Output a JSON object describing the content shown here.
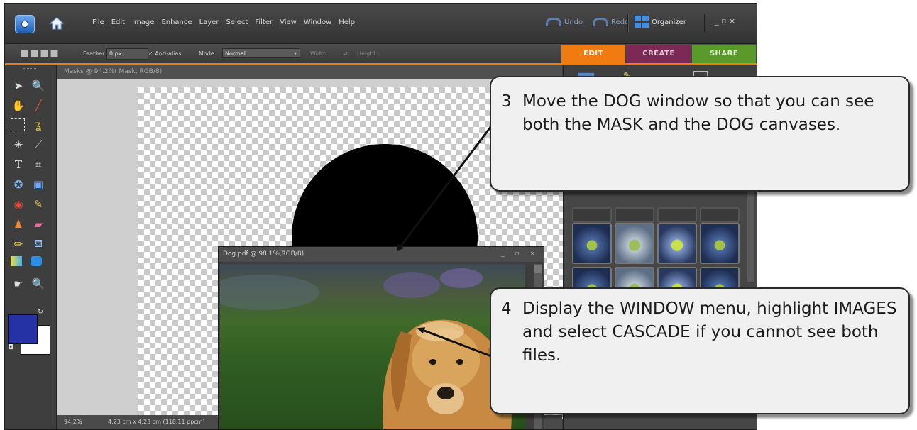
{
  "menubar": {
    "items": [
      "File",
      "Edit",
      "Image",
      "Enhance",
      "Layer",
      "Select",
      "Filter",
      "View",
      "Window",
      "Help"
    ],
    "undo_label": "Undo",
    "redo_label": "Redo",
    "organizer_label": "Organizer",
    "window_controls": "_  ▫  ×"
  },
  "options": {
    "feather_label": "Feather:",
    "feather_value": "0 px",
    "antialias_label": "Anti-alias",
    "mode_label": "Mode:",
    "mode_value": "Normal",
    "width_label": "Width:",
    "height_label": "Height:"
  },
  "tabs": {
    "edit": "EDIT",
    "create": "CREATE",
    "share": "SHARE"
  },
  "colors": {
    "edit_tab": "#f07b10",
    "create_tab": "#7c2a55",
    "share_tab": "#5a9a2a",
    "foreground": "#2631a6",
    "background": "#ffffff"
  },
  "document": {
    "title": "Masks @ 94.2%( Mask, RGB/8)",
    "zoom": "94.2%",
    "size_info": "4.23 cm x 4.23 cm (118.11 ppcm)"
  },
  "dog_window": {
    "title": "Dog.pdf @ 98.1%(RGB/8)",
    "controls": "_ ▫ ×"
  },
  "callouts": [
    {
      "num": "3",
      "text": "Move the DOG window so that you can see both the MASK and the DOG canvases."
    },
    {
      "num": "4",
      "text": "Display the WINDOW menu, highlight IMAGES and select CASCADE if you cannot see both files."
    }
  ]
}
